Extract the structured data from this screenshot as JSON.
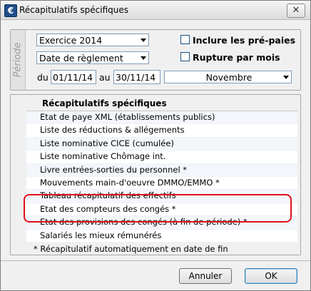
{
  "window": {
    "title": "Récapitulatifs spécifiques",
    "close_symbol": "✕",
    "app_icon_glyph": "€"
  },
  "periode": {
    "label": "Période",
    "exercice": "Exercice 2014",
    "date_mode": "Date de règlement",
    "inclure_label": "Inclure les pré-paies",
    "rupture_label": "Rupture par mois",
    "du_label": "du",
    "du_value": "01/11/14",
    "au_label": "au",
    "au_value": "30/11/14",
    "mois": "Novembre"
  },
  "list": {
    "header": "Récapitulatifs spécifiques",
    "items": [
      "Etat de paye XML (établissements publics)",
      "Liste des réductions & allégements",
      "Liste nominative CICE (cumulée)",
      "Liste nominative Chômage int.",
      "Livre entrées-sorties du personnel *",
      "Mouvements main-d'oeuvre DMMO/EMMO *",
      "Tableau récapitulatif des effectifs",
      "Etat des compteurs des congés *",
      "Etat des provisions des congés (à fin de période) *",
      "Salariés les mieux rémunérés"
    ],
    "footnote": "* Récapitulatif automatiquement en date de fin"
  },
  "buttons": {
    "cancel": "Annuler",
    "ok": "OK"
  },
  "colors": {
    "highlight": "#e0101a"
  }
}
